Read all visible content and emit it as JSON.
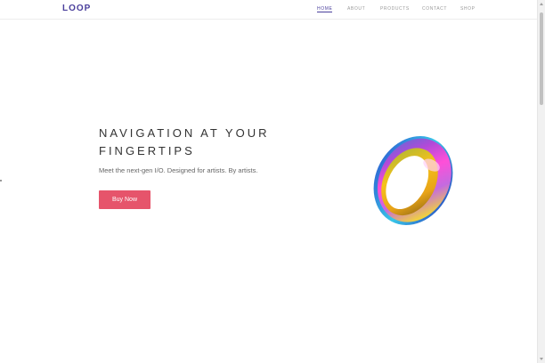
{
  "header": {
    "logo": "LOOP",
    "nav": [
      {
        "label": "HOME",
        "active": true
      },
      {
        "label": "ABOUT",
        "active": false
      },
      {
        "label": "PRODUCTS",
        "active": false
      },
      {
        "label": "CONTACT",
        "active": false
      },
      {
        "label": "SHOP",
        "active": false
      }
    ]
  },
  "hero": {
    "title_line1": "NAVIGATION AT YOUR",
    "title_line2": "FINGERTIPS",
    "subtitle": "Meet the next-gen I/O. Designed for artists. By artists.",
    "cta_label": "Buy Now",
    "image": "iridescent-ring"
  },
  "colors": {
    "brand": "#4a3f9c",
    "cta": "#e6546b",
    "text": "#333333",
    "muted": "#9a9a9a"
  }
}
